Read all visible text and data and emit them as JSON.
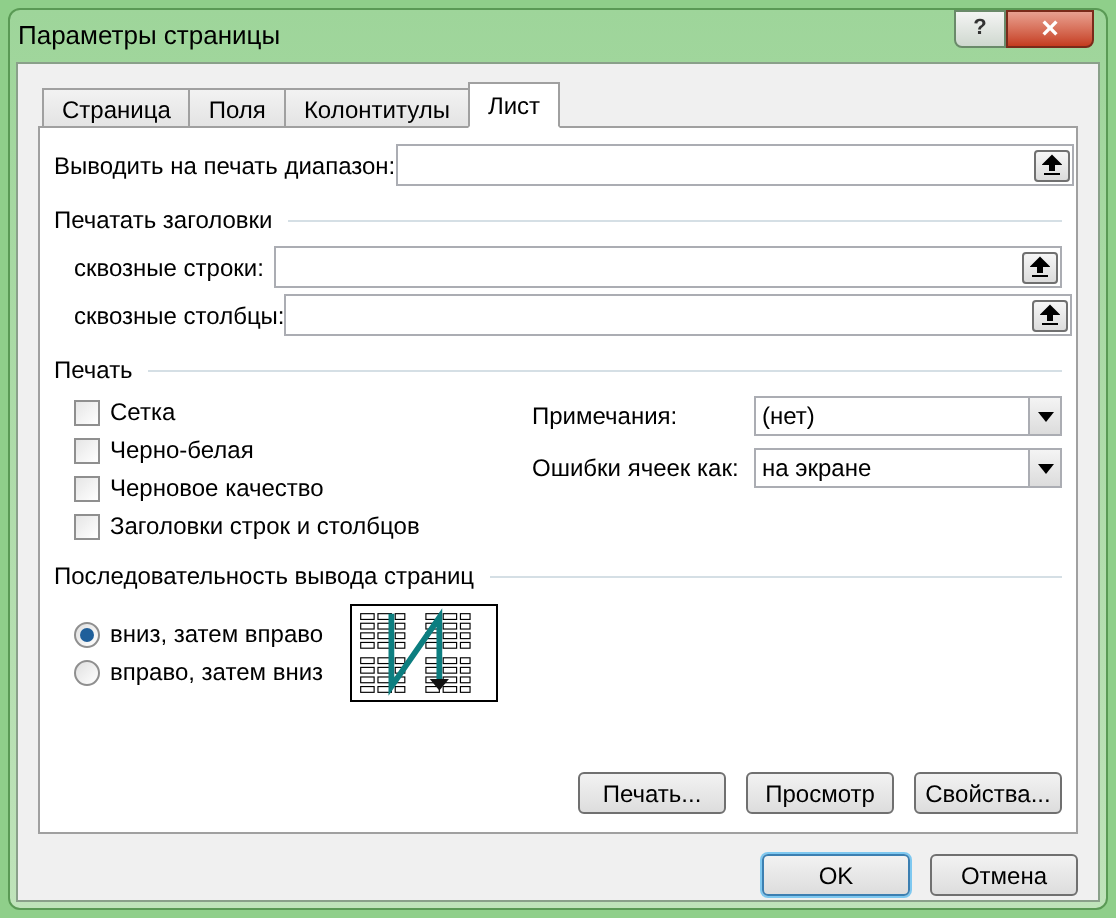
{
  "window": {
    "title": "Параметры страницы",
    "help": "?",
    "close": "×"
  },
  "tabs": [
    {
      "label": "Страница",
      "selected": false
    },
    {
      "label": "Поля",
      "selected": false
    },
    {
      "label": "Колонтитулы",
      "selected": false
    },
    {
      "label": "Лист",
      "selected": true
    }
  ],
  "print_area": {
    "label": "Выводить на печать диапазон:"
  },
  "print_titles": {
    "title": "Печатать заголовки",
    "rows": [
      {
        "label": "сквозные строки:"
      },
      {
        "label": "сквозные столбцы:"
      }
    ]
  },
  "print": {
    "title": "Печать",
    "options": [
      {
        "label": "Сетка",
        "checked": false
      },
      {
        "label": "Черно-белая",
        "checked": false
      },
      {
        "label": "Черновое качество",
        "checked": false
      },
      {
        "label": "Заголовки строк и столбцов",
        "checked": false
      }
    ],
    "selects": [
      {
        "label": "Примечания:",
        "value": "(нет)"
      },
      {
        "label": "Ошибки ячеек как:",
        "value": "на экране"
      }
    ]
  },
  "page_order": {
    "title": "Последовательность вывода страниц",
    "options": [
      {
        "label": "вниз, затем вправо",
        "selected": true
      },
      {
        "label": "вправо, затем вниз",
        "selected": false
      }
    ]
  },
  "panel_buttons": [
    "Печать...",
    "Просмотр",
    "Свойства..."
  ],
  "dialog_buttons": [
    {
      "label": "OK",
      "default": true
    },
    {
      "label": "Отмена",
      "default": false
    }
  ]
}
